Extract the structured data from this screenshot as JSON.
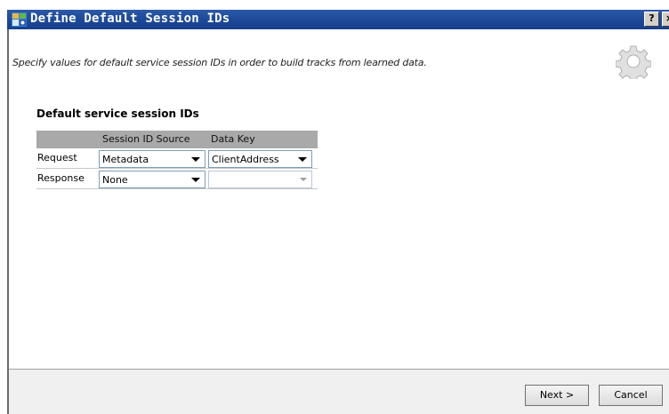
{
  "window": {
    "title": "Define Default Session IDs",
    "help_label": "?",
    "close_label": "×"
  },
  "description": "Specify values for default service session IDs in order to build tracks from learned data.",
  "section_title": "Default service session IDs",
  "grid": {
    "columns": [
      "",
      "Session ID Source",
      "Data Key"
    ],
    "rows": [
      {
        "label": "Request",
        "source": "Metadata",
        "data_key": "ClientAddress"
      },
      {
        "label": "Response",
        "source": "None",
        "data_key": ""
      }
    ]
  },
  "buttons": {
    "next": "Next >",
    "cancel": "Cancel"
  }
}
